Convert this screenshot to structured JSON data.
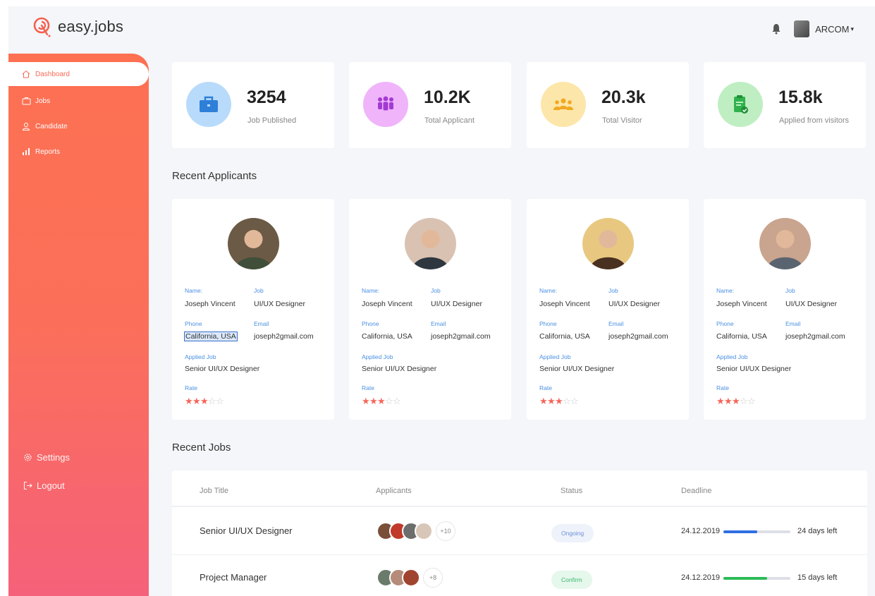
{
  "app": {
    "name": "easy.jobs"
  },
  "header": {
    "user_name": "ARCOM",
    "icons": [
      "bell-icon",
      "user-avatar",
      "chevron-down-icon"
    ]
  },
  "sidebar": {
    "items": [
      {
        "label": "Dashboard",
        "icon": "home-icon",
        "active": true
      },
      {
        "label": "Jobs",
        "icon": "briefcase-icon",
        "active": false
      },
      {
        "label": "Candidate",
        "icon": "user-icon",
        "active": false
      },
      {
        "label": "Reports",
        "icon": "bar-chart-icon",
        "active": false
      }
    ],
    "bottom_items": [
      {
        "label": "Settings",
        "icon": "gear-icon"
      },
      {
        "label": "Logout",
        "icon": "logout-icon"
      }
    ]
  },
  "stats": [
    {
      "value": "3254",
      "label": "Job Published",
      "icon": "briefcase-icon",
      "color": "#4a90e2",
      "bg": "#b9dbfb"
    },
    {
      "value": "10.2K",
      "label": "Total Applicant",
      "icon": "people-icon",
      "color": "#a23bd2",
      "bg": "#f0b4fb"
    },
    {
      "value": "20.3k",
      "label": "Total Visitor",
      "icon": "group-icon",
      "color": "#f2a821",
      "bg": "#fde6a9"
    },
    {
      "value": "15.8k",
      "label": "Applied from visitors",
      "icon": "clipboard-check-icon",
      "color": "#2fb24c",
      "bg": "#bfeec3"
    }
  ],
  "recent_applicants": {
    "title": "Recent Applicants",
    "labels": {
      "name": "Name:",
      "job": "Job",
      "phone": "Phone",
      "email": "Email",
      "applied_job": "Applied Job",
      "rate": "Rate"
    },
    "cards": [
      {
        "name": "Joseph Vincent",
        "job": "UI/UX Designer",
        "phone": "California, USA",
        "email": "joseph2gmail.com",
        "applied_job": "Senior UI/UX Designer",
        "rating": 3,
        "max_rating": 5,
        "phone_selected": true
      },
      {
        "name": "Joseph Vincent",
        "job": "UI/UX Designer",
        "phone": "California, USA",
        "email": "joseph2gmail.com",
        "applied_job": "Senior UI/UX Designer",
        "rating": 3,
        "max_rating": 5,
        "phone_selected": false
      },
      {
        "name": "Joseph Vincent",
        "job": "UI/UX Designer",
        "phone": "California, USA",
        "email": "joseph2gmail.com",
        "applied_job": "Senior UI/UX Designer",
        "rating": 3,
        "max_rating": 5,
        "phone_selected": false
      },
      {
        "name": "Joseph Vincent",
        "job": "UI/UX Designer",
        "phone": "California, USA",
        "email": "joseph2gmail.com",
        "applied_job": "Senior UI/UX Designer",
        "rating": 3,
        "max_rating": 5,
        "phone_selected": false
      }
    ]
  },
  "recent_jobs": {
    "title": "Recent Jobs",
    "columns": [
      "Job Title",
      "Applicants",
      "Status",
      "Deadline"
    ],
    "rows": [
      {
        "title": "Senior UI/UX Designer",
        "applicant_count": 4,
        "more": "+10",
        "status": "Ongoing",
        "status_color": "#6c8fd6",
        "status_bg": "#eef2fb",
        "deadline": "24.12.2019",
        "progress": 0.5,
        "progress_color": "#2f6fe0",
        "days_left": "24 days left"
      },
      {
        "title": "Project Manager",
        "applicant_count": 3,
        "more": "+8",
        "status": "Confirm",
        "status_color": "#3bb870",
        "status_bg": "#e6f7ec",
        "deadline": "24.12.2019",
        "progress": 0.65,
        "progress_color": "#2cbb58",
        "days_left": "15 days left"
      }
    ]
  }
}
